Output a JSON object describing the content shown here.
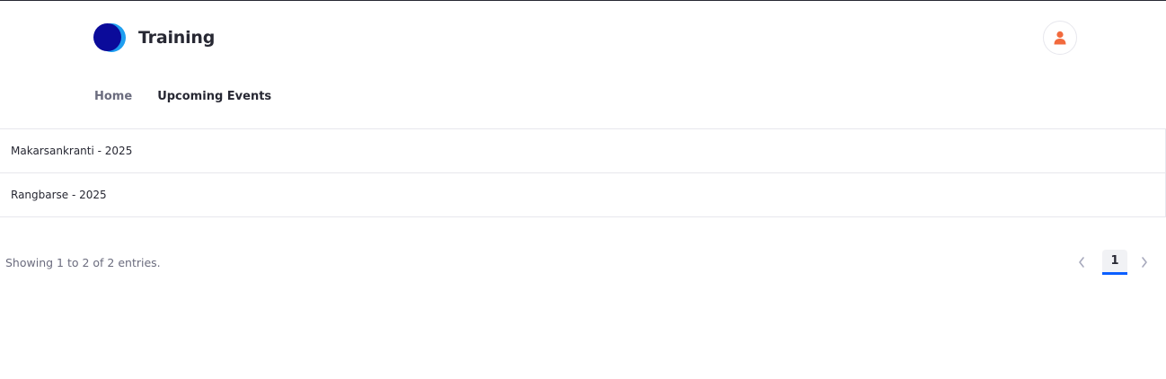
{
  "header": {
    "site_title": "Training",
    "logo_icon": "site-logo",
    "user_icon": "user-icon",
    "user_icon_color": "#f26a3d"
  },
  "nav": {
    "items": [
      {
        "label": "Home"
      },
      {
        "label": "Upcoming Events"
      }
    ]
  },
  "events": {
    "rows": [
      {
        "title": "Makarsankranti - 2025"
      },
      {
        "title": "Rangbarse - 2025"
      }
    ]
  },
  "pagination": {
    "summary": "Showing 1 to 2 of 2 entries.",
    "current_page": "1",
    "prev_icon": "chevron-left-icon",
    "next_icon": "chevron-right-icon",
    "accent_color": "#0b5fff"
  }
}
